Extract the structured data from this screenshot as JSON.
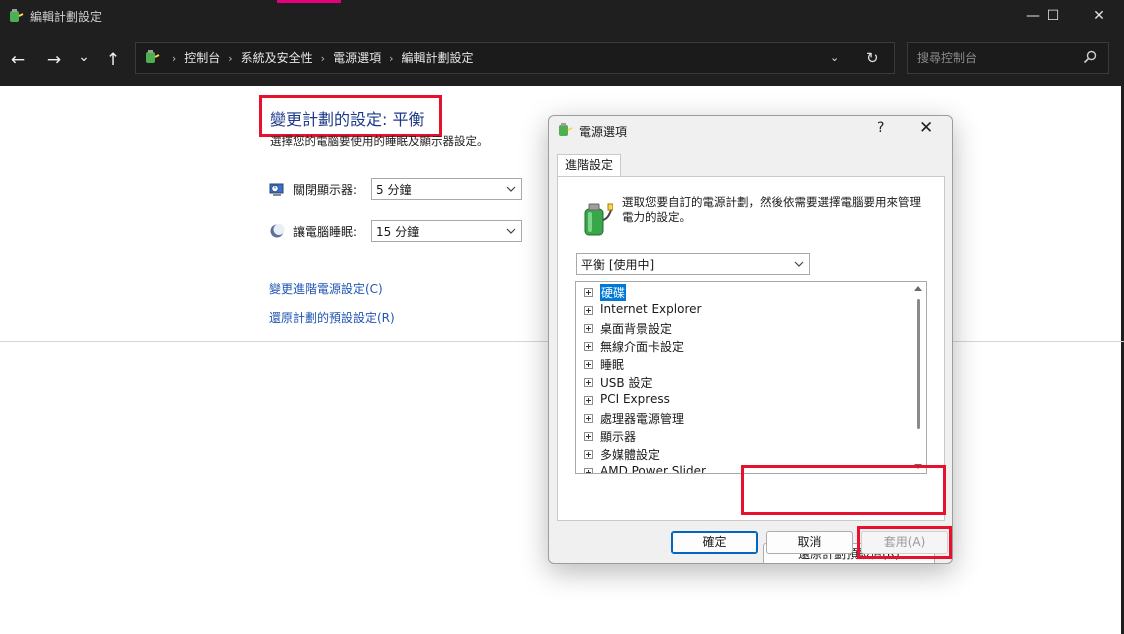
{
  "window": {
    "title": "編輯計劃設定",
    "minimize_glyph": "—",
    "maximize_glyph": "☐",
    "close_glyph": "✕"
  },
  "nav": {
    "back_glyph": "←",
    "forward_glyph": "→",
    "recent_glyph": "⌄",
    "up_glyph": "↑",
    "breadcrumbs": [
      "控制台",
      "系統及安全性",
      "電源選項",
      "編輯計劃設定"
    ],
    "refresh_glyph": "↻",
    "search_placeholder": "搜尋控制台"
  },
  "page": {
    "heading": "變更計劃的設定: 平衡",
    "subtitle": "選擇您的電腦要使用的睡眠及顯示器設定。",
    "display_label": "關閉顯示器:",
    "display_value": "5 分鐘",
    "sleep_label": "讓電腦睡眠:",
    "sleep_value": "15 分鐘",
    "link_advanced": "變更進階電源設定(C)",
    "link_restore": "還原計劃的預設設定(R)"
  },
  "dialog": {
    "title": "電源選項",
    "help": "?",
    "close": "✕",
    "tab": "進階設定",
    "description": "選取您要自訂的電源計劃，然後依需要選擇電腦要用來管理電力的設定。",
    "plan_value": "平衡 [使用中]",
    "tree_items": [
      {
        "label": "硬碟",
        "selected": true
      },
      {
        "label": "Internet Explorer",
        "selected": false
      },
      {
        "label": "桌面背景設定",
        "selected": false
      },
      {
        "label": "無線介面卡設定",
        "selected": false
      },
      {
        "label": "睡眠",
        "selected": false
      },
      {
        "label": "USB 設定",
        "selected": false
      },
      {
        "label": "PCI Express",
        "selected": false
      },
      {
        "label": "處理器電源管理",
        "selected": false
      },
      {
        "label": "顯示器",
        "selected": false
      },
      {
        "label": "多媒體設定",
        "selected": false
      },
      {
        "label": "AMD Power Slider",
        "selected": false
      }
    ],
    "restore_button": "還原計劃預設值(R)",
    "ok_button": "確定",
    "cancel_button": "取消",
    "apply_button": "套用(A)"
  },
  "colors": {
    "titlebar": "#1f1f1f",
    "link": "#1f55b4",
    "heading": "#1d3a8a",
    "annotation": "#e8112d",
    "selection": "#0078d7"
  }
}
